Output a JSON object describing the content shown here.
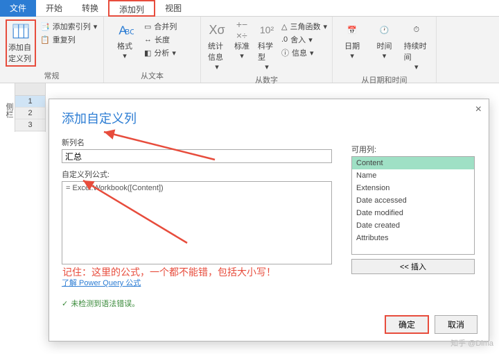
{
  "tabs": {
    "file": "文件",
    "start": "开始",
    "convert": "转换",
    "addcol": "添加列",
    "view": "视图"
  },
  "ribbon": {
    "custom_col": "添加自定义列",
    "index_col": "添加索引列",
    "duplicate": "重复列",
    "format": "格式",
    "merge": "合并列",
    "length": "长度",
    "parse": "分析",
    "stats": "统计信息",
    "standard": "标准",
    "sci": "科学型",
    "trig": "三角函数",
    "round": "舍入",
    "info": "信息",
    "date": "日期",
    "time": "时间",
    "duration": "持续时间",
    "g1": "常规",
    "g2": "从文本",
    "g3": "从数字",
    "g4": "从日期和时间"
  },
  "side": "侧栏",
  "rows": [
    "1",
    "2",
    "3"
  ],
  "dialog": {
    "title": "添加自定义列",
    "new_col": "新列名",
    "new_val": "汇总",
    "formula_label": "自定义列公式:",
    "formula": "= Excel.Workbook([Content])",
    "available": "可用列:",
    "cols": [
      "Content",
      "Name",
      "Extension",
      "Date accessed",
      "Date modified",
      "Date created",
      "Attributes"
    ],
    "insert": "<< 插入",
    "learn": "了解 Power Query 公式",
    "status": "未检测到语法错误。",
    "ok": "确定",
    "cancel": "取消"
  },
  "annotation": "记住：这里的公式，一个都不能错，包括大小写！",
  "watermark": "知乎 @Dima"
}
